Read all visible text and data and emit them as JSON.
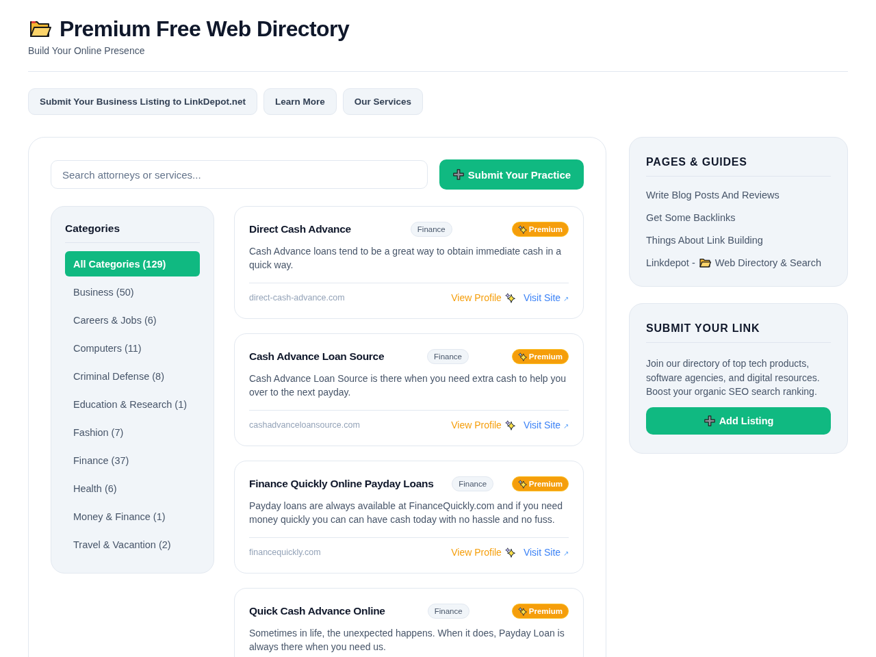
{
  "header": {
    "title": "Premium Free Web Directory",
    "subtitle": "Build Your Online Presence"
  },
  "nav_buttons": [
    "Submit Your Business Listing to LinkDepot.net",
    "Learn More",
    "Our Services"
  ],
  "search": {
    "placeholder": "Search attorneys or services..."
  },
  "submit_button": "Submit Your Practice",
  "categories": {
    "title": "Categories",
    "items": [
      {
        "label": "All Categories (129)",
        "selected": true
      },
      {
        "label": "Business (50)",
        "selected": false
      },
      {
        "label": "Careers & Jobs (6)",
        "selected": false
      },
      {
        "label": "Computers (11)",
        "selected": false
      },
      {
        "label": "Criminal Defense (8)",
        "selected": false
      },
      {
        "label": "Education & Research (1)",
        "selected": false
      },
      {
        "label": "Fashion (7)",
        "selected": false
      },
      {
        "label": "Finance (37)",
        "selected": false
      },
      {
        "label": "Health (6)",
        "selected": false
      },
      {
        "label": "Money & Finance (1)",
        "selected": false
      },
      {
        "label": "Travel & Vacantion (2)",
        "selected": false
      }
    ]
  },
  "listings": [
    {
      "title": "Direct Cash Advance",
      "category": "Finance",
      "badge": "Premium",
      "description": "Cash Advance loans tend to be a great way to obtain immediate cash in a quick way.",
      "domain": "direct-cash-advance.com",
      "profile_link": "View Profile",
      "site_link": "Visit Site",
      "site_arrow": "↗"
    },
    {
      "title": "Cash Advance Loan Source",
      "category": "Finance",
      "badge": "Premium",
      "description": "Cash Advance Loan Source is there when you need extra cash to help you over to the next payday.",
      "domain": "cashadvanceloansource.com",
      "profile_link": "View Profile",
      "site_link": "Visit Site",
      "site_arrow": "↗"
    },
    {
      "title": "Finance Quickly Online Payday Loans",
      "category": "Finance",
      "badge": "Premium",
      "description": "Payday loans are always available at FinanceQuickly.com and if you need money quickly you can can have cash today with no hassle and no fuss.",
      "domain": "financequickly.com",
      "profile_link": "View Profile",
      "site_link": "Visit Site",
      "site_arrow": "↗"
    },
    {
      "title": "Quick Cash Advance Online",
      "category": "Finance",
      "badge": "Premium",
      "description": "Sometimes in life, the unexpected happens. When it does, Payday Loan is always there when you need us."
    }
  ],
  "sidebar": {
    "guides": {
      "title": "PAGES & GUIDES",
      "links": [
        {
          "kind": "text",
          "label": "Write Blog Posts And Reviews"
        },
        {
          "kind": "text",
          "label": "Get Some Backlinks"
        },
        {
          "kind": "text",
          "label": "Things About Link Building"
        },
        {
          "kind": "folder",
          "label": "Linkdepot -",
          "label_after": "Web Directory & Search"
        }
      ]
    },
    "submit": {
      "title": "SUBMIT YOUR LINK",
      "text": "Join our directory of top tech products, software agencies, and digital resources. Boost your organic SEO search ranking.",
      "button": "Add Listing"
    }
  }
}
